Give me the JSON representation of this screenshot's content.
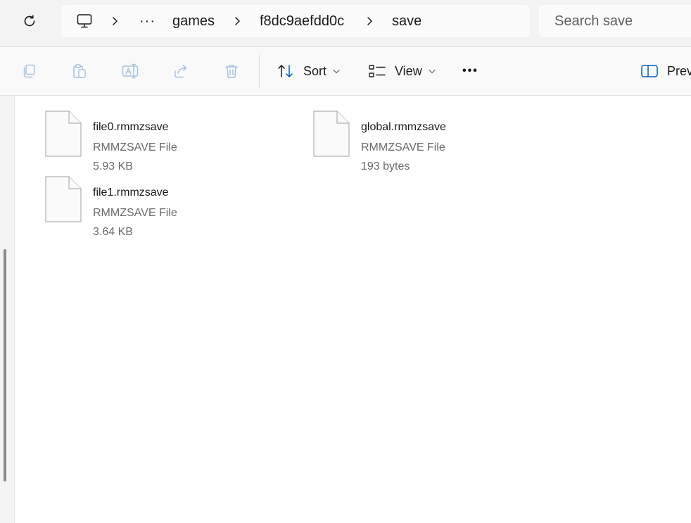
{
  "address_bar": {
    "breadcrumbs": [
      {
        "label": "games"
      },
      {
        "label": "f8dc9aefdd0c"
      },
      {
        "label": "save"
      }
    ],
    "overflow_label": "···",
    "search_placeholder": "Search save"
  },
  "command_bar": {
    "sort_label": "Sort",
    "view_label": "View",
    "more_label": "•••",
    "preview_label": "Preview"
  },
  "files": [
    {
      "name": "file0.rmmzsave",
      "type": "RMMZSAVE File",
      "size": "5.93 KB"
    },
    {
      "name": "global.rmmzsave",
      "type": "RMMZSAVE File",
      "size": "193 bytes"
    },
    {
      "name": "file1.rmmzsave",
      "type": "RMMZSAVE File",
      "size": "3.64 KB"
    }
  ],
  "colors": {
    "accent": "#005fb8",
    "disabled_icon": "#a9c1de",
    "chrome_bg": "#f3f3f3"
  }
}
